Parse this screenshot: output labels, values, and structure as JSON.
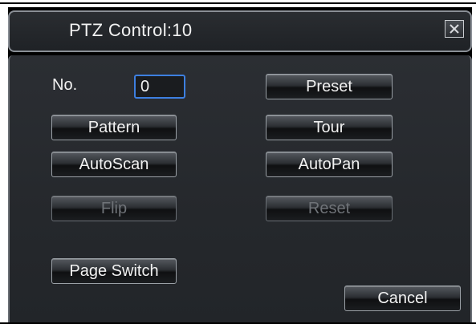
{
  "dialog": {
    "title": "PTZ Control:10",
    "close_icon": "close-x-icon"
  },
  "form": {
    "no_label": "No.",
    "no_value": "0"
  },
  "buttons": {
    "preset": "Preset",
    "pattern": "Pattern",
    "tour": "Tour",
    "autoscan": "AutoScan",
    "autopan": "AutoPan",
    "flip": "Flip",
    "reset": "Reset",
    "page_switch": "Page Switch",
    "cancel": "Cancel"
  },
  "colors": {
    "focus_border": "#3d7fe0",
    "disabled_text": "#6f7378"
  }
}
